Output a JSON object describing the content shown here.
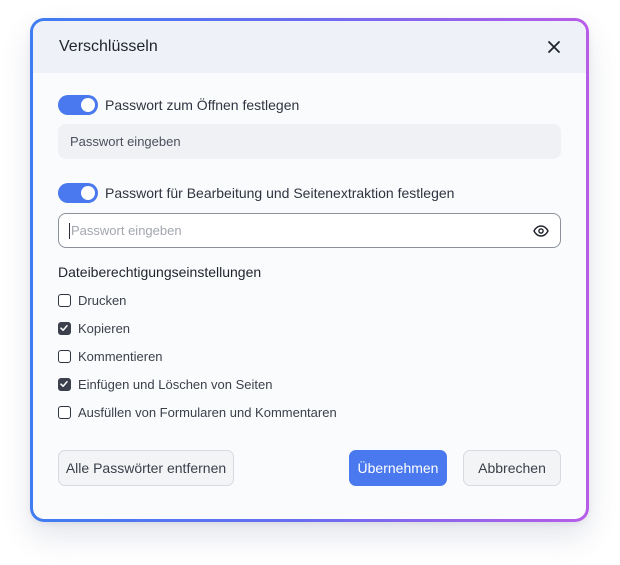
{
  "dialog": {
    "title": "Verschlüsseln",
    "close_icon": "close-icon"
  },
  "open_password": {
    "toggle_on": true,
    "label": "Passwort zum Öffnen festlegen",
    "input_value": "Passwort eingeben"
  },
  "edit_password": {
    "toggle_on": true,
    "label": "Passwort für Bearbeitung und Seitenextraktion festlegen",
    "input_placeholder": "Passwort eingeben",
    "visibility_icon": "eye-icon"
  },
  "permissions": {
    "title": "Dateiberechtigungseinstellungen",
    "items": [
      {
        "label": "Drucken",
        "checked": false
      },
      {
        "label": "Kopieren",
        "checked": true
      },
      {
        "label": "Kommentieren",
        "checked": false
      },
      {
        "label": "Einfügen und Löschen von Seiten",
        "checked": true
      },
      {
        "label": "Ausfüllen von Formularen und Kommentaren",
        "checked": false
      }
    ]
  },
  "footer": {
    "remove_label": "Alle Passwörter entfernen",
    "apply_label": "Übernehmen",
    "cancel_label": "Abbrechen"
  },
  "colors": {
    "accent": "#4a78ee",
    "gradient_start": "#3f7cf2",
    "gradient_end": "#b85ce8"
  }
}
